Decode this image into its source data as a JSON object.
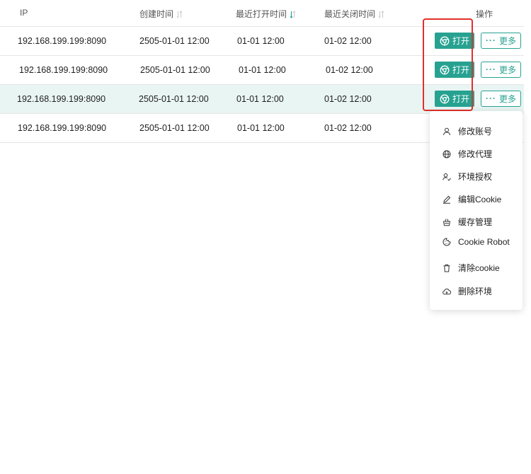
{
  "table": {
    "headers": {
      "ip": "IP",
      "created": "创建时间",
      "last_open": "最近打开时间",
      "last_close": "最近关闭时间",
      "actions": "操作"
    },
    "rows": [
      {
        "ip": "192.168.199.199:8090",
        "created": "2505-01-01 12:00",
        "last_open": "01-01 12:00",
        "last_close": "01-02 12:00"
      },
      {
        "ip": "192.168.199.199:8090",
        "created": "2505-01-01 12:00",
        "last_open": "01-01 12:00",
        "last_close": "01-02 12:00"
      },
      {
        "ip": "192.168.199.199:8090",
        "created": "2505-01-01 12:00",
        "last_open": "01-01 12:00",
        "last_close": "01-02 12:00"
      },
      {
        "ip": "192.168.199.199:8090",
        "created": "2505-01-01 12:00",
        "last_open": "01-01 12:00",
        "last_close": "01-02 12:00"
      }
    ],
    "open_label": "打开",
    "more_label": "更多"
  },
  "menu": {
    "items": [
      {
        "label": "修改账号",
        "icon": "user-icon"
      },
      {
        "label": "修改代理",
        "icon": "globe-icon"
      },
      {
        "label": "环境授权",
        "icon": "user-check-icon"
      },
      {
        "label": "编辑Cookie",
        "icon": "edit-icon"
      },
      {
        "label": "缓存管理",
        "icon": "basket-icon"
      },
      {
        "label": "Cookie Robot",
        "icon": "cookie-icon"
      },
      {
        "label": "清除cookie",
        "icon": "trash-icon"
      },
      {
        "label": "删除环境",
        "icon": "cloud-icon"
      }
    ]
  },
  "colors": {
    "accent": "#27a291",
    "highlight_row": "#e9f5f3",
    "annotation_box": "#e0302a"
  }
}
